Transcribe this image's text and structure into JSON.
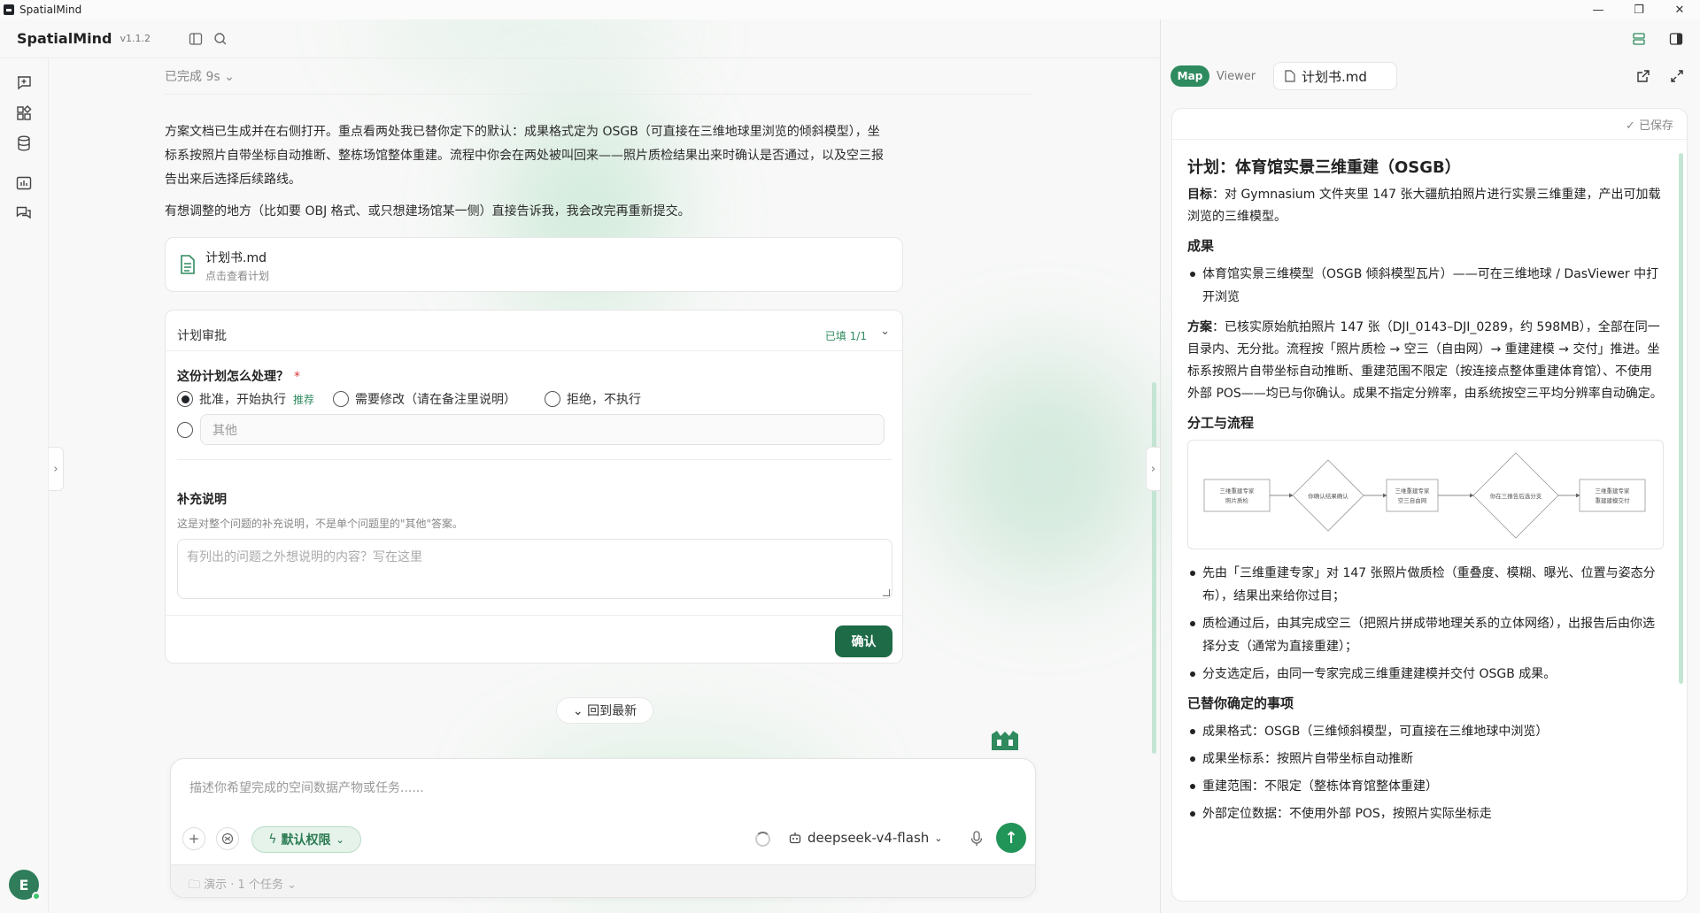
{
  "window": {
    "title": "SpatialMind",
    "controls": [
      "—",
      "❐",
      "✕"
    ]
  },
  "header": {
    "brand": "SpatialMind",
    "version": "v1.1.2"
  },
  "chat": {
    "done_status": "已完成 9s ⌄",
    "paragraph1": "方案文档已生成并在右侧打开。重点看两处我已替你定下的默认：成果格式定为 OSGB（可直接在三维地球里浏览的倾斜模型），坐标系按照片自带坐标自动推断、整栋场馆整体重建。流程中你会在两处被叫回来——照片质检结果出来时确认是否通过，以及空三报告出来后选择后续路线。",
    "paragraph2": "有想调整的地方（比如要 OBJ 格式、或只想建场馆某一侧）直接告诉我，我会改完再重新提交。",
    "file_card": {
      "name": "计划书.md",
      "sub": "点击查看计划"
    },
    "approval": {
      "title": "计划审批",
      "filled": "已填 1/1",
      "question": "这份计划怎么处理？",
      "required": "*",
      "options": [
        {
          "label": "批准，开始执行",
          "tag": "推荐",
          "checked": true
        },
        {
          "label": "需要修改（请在备注里说明）",
          "checked": false
        },
        {
          "label": "拒绝，不执行",
          "checked": false
        }
      ],
      "other_placeholder": "其他",
      "supplement_title": "补充说明",
      "supplement_desc": "这是对整个问题的补充说明，不是单个问题里的\"其他\"答案。",
      "supplement_placeholder": "有列出的问题之外想说明的内容？写在这里",
      "confirm": "确认"
    },
    "back_to_latest": "⌄ 回到最新"
  },
  "composer": {
    "placeholder": "描述你希望完成的空间数据产物或任务......",
    "permission": "默认权限",
    "model": "deepseek-v4-flash",
    "footer": "演示 · 1 个任务"
  },
  "panel": {
    "tabs": {
      "map": "Map",
      "viewer": "Viewer",
      "file": "计划书.md"
    },
    "saved": "✓ 已保存",
    "doc": {
      "title": "计划：体育馆实景三维重建（OSGB）",
      "goal_label": "目标",
      "goal": "：对 Gymnasium 文件夹里 147 张大疆航拍照片进行实景三维重建，产出可加载浏览的三维模型。",
      "deliverable_heading": "成果",
      "deliverables": [
        "体育馆实景三维模型（OSGB 倾斜模型瓦片）——可在三维地球 / DasViewer 中打开浏览"
      ],
      "plan_label": "方案",
      "plan": "：已核实原始航拍照片 147 张（DJI_0143–DJI_0289，约 598MB），全部在同一目录内、无分批。流程按「照片质检 → 空三（自由网）→ 重建建模 → 交付」推进。坐标系按照片自带坐标自动推断、重建范围不限定（按连接点整体重建体育馆）、不使用外部 POS——均已与你确认。成果不指定分辨率，由系统按空三平均分辨率自动确定。",
      "flow_heading": "分工与流程",
      "flow_nodes": [
        "三维重建专家\n照片质检",
        "你确认结果确认",
        "三维重建专家\n空三自由网",
        "你在三报告后选分支",
        "三维重建专家\n重建建模交付"
      ],
      "flow_items": [
        "先由「三维重建专家」对 147 张照片做质检（重叠度、模糊、曝光、位置与姿态分布），结果出来给你过目；",
        "质检通过后，由其完成空三（把照片拼成带地理关系的立体网络），出报告后由你选择分支（通常为直接重建）；",
        "分支选定后，由同一专家完成三维重建建模并交付 OSGB 成果。"
      ],
      "decided_heading": "已替你确定的事项",
      "decided_items": [
        "成果格式：OSGB（三维倾斜模型，可直接在三维地球中浏览）",
        "成果坐标系：按照片自带坐标自动推断",
        "重建范围：不限定（整栋体育馆整体重建）",
        "外部定位数据：不使用外部 POS，按照片实际坐标走"
      ]
    }
  },
  "user": {
    "avatar_initial": "E"
  },
  "colors": {
    "accent": "#219558",
    "accent_dark": "#1e6b47",
    "accent_light": "#e6f3ea"
  }
}
